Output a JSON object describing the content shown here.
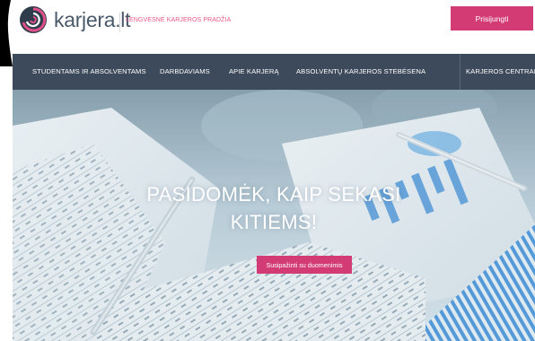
{
  "brand": {
    "name": "karjera.lt",
    "tagline": "LENGVESNĖ KARJEROS PRADŽIA",
    "logo_icon": "spiral-logo-icon",
    "colors": {
      "accent": "#d23b74",
      "nav_bg": "#3d4a5c",
      "logo_text": "#4a5a6b"
    }
  },
  "header": {
    "login_label": "Prisijungti"
  },
  "nav": {
    "items": [
      {
        "label": "STUDENTAMS IR ABSOLVENTAMS"
      },
      {
        "label": "DARBDAVIAMS"
      },
      {
        "label": "APIE KARJERĄ"
      },
      {
        "label": "ABSOLVENTŲ KARJEROS STEBĖSENA"
      },
      {
        "label": "KARJEROS CENTRAI"
      }
    ]
  },
  "hero": {
    "title_line1": "PASIDOMĖK, KAIP SEKASI",
    "title_line2": "KITIEMS!",
    "cta_label": "Susipažinti su duomenimis"
  }
}
